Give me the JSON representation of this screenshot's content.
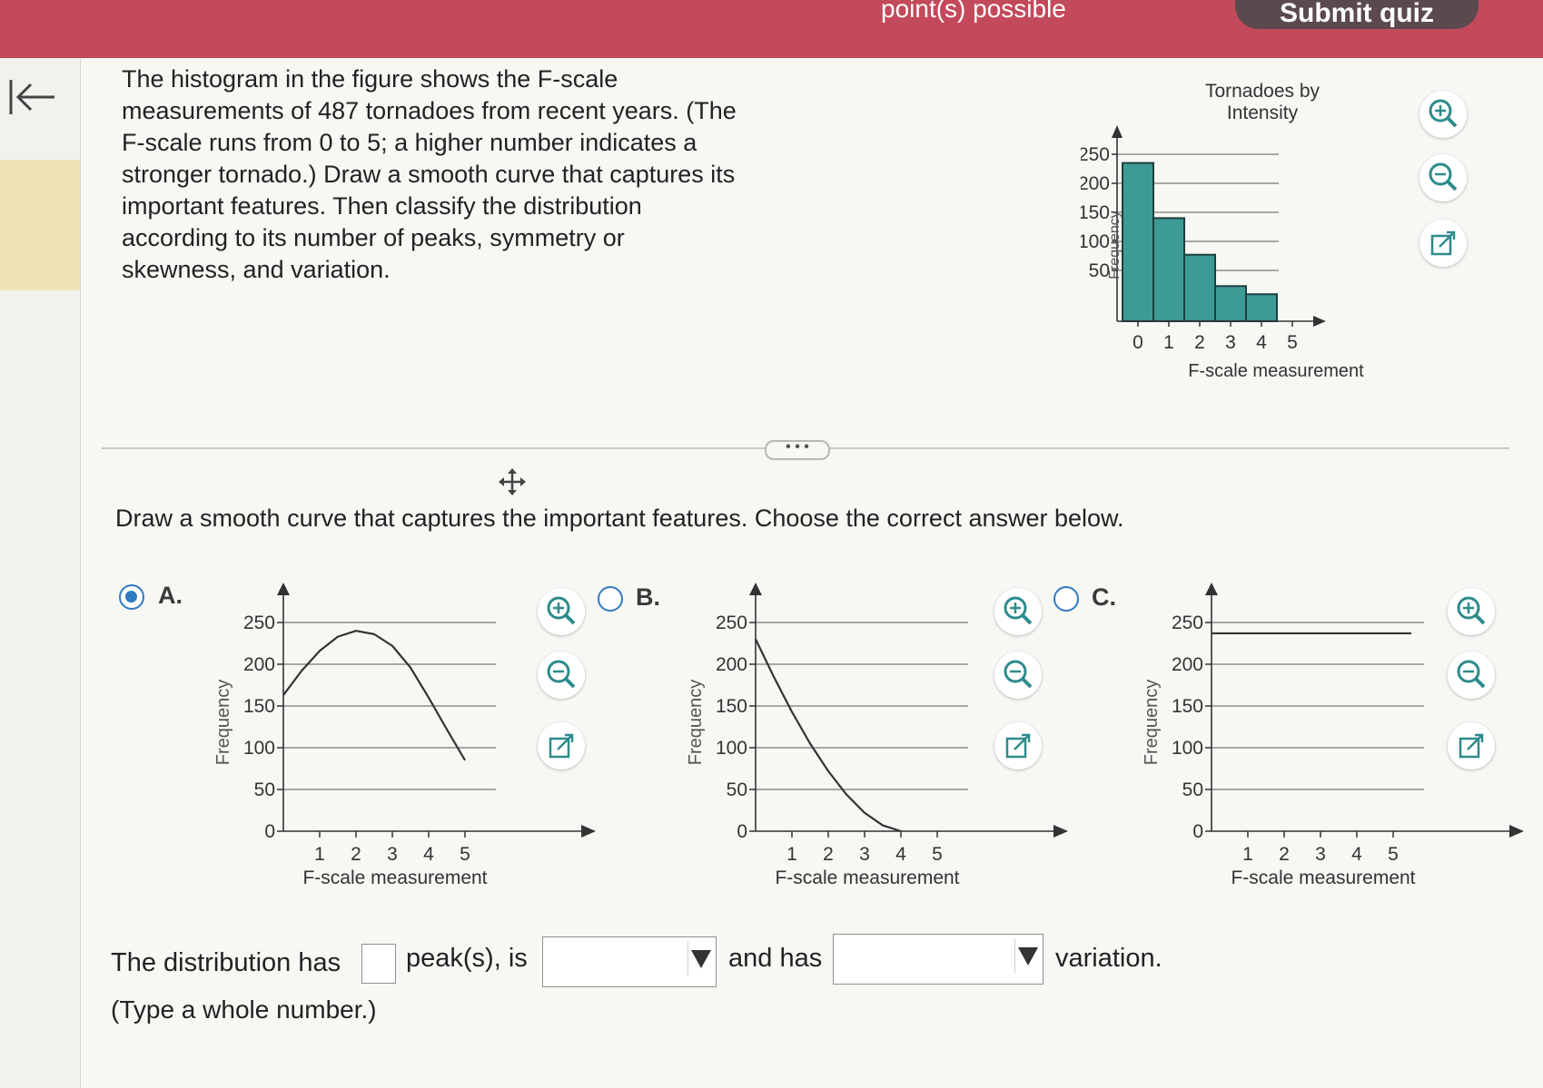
{
  "header": {
    "points_text": "point(s) possible",
    "submit_label": "Submit quiz"
  },
  "question": {
    "text": "The histogram in the figure shows the F-scale measurements of 487 tornadoes from recent years. (The F-scale runs from 0 to 5; a higher number indicates a stronger tornado.) Draw a smooth curve that captures its important features. Then classify the distribution according to its number of peaks, symmetry or skewness, and variation."
  },
  "instruction": "Draw a smooth curve that captures the important features. Choose the correct answer below.",
  "options": [
    {
      "letter": "A.",
      "selected": true
    },
    {
      "letter": "B.",
      "selected": false
    },
    {
      "letter": "C.",
      "selected": false
    }
  ],
  "answer": {
    "part1": "The distribution has",
    "part2": "peak(s), is",
    "part3": "and has",
    "part4": "variation.",
    "peaks_value": "",
    "symmetry_value": "",
    "variation_value": "",
    "hint": "(Type a whole number.)"
  },
  "chart_data": [
    {
      "type": "bar",
      "title": "Tornadoes by Intensity",
      "xlabel": "F-scale measurement",
      "ylabel": "Frequency",
      "categories": [
        "0",
        "1",
        "2",
        "3",
        "4",
        "5"
      ],
      "values": [
        235,
        140,
        77,
        23,
        9,
        0
      ],
      "yticks": [
        50,
        100,
        150,
        200,
        250
      ],
      "ylim": [
        0,
        270
      ],
      "xlim": [
        0,
        6
      ]
    },
    {
      "type": "line",
      "option": "A",
      "xlabel": "F-scale measurement",
      "ylabel": "Frequency",
      "x": [
        0,
        0.5,
        1,
        1.5,
        2,
        2.5,
        3,
        3.5,
        4,
        4.5,
        5
      ],
      "values": [
        163,
        192,
        216,
        233,
        240,
        236,
        222,
        196,
        160,
        122,
        85
      ],
      "xticks": [
        1,
        2,
        3,
        4,
        5
      ],
      "yticks": [
        0,
        50,
        100,
        150,
        200,
        250
      ],
      "ylim": [
        0,
        270
      ],
      "xlim": [
        0,
        6
      ]
    },
    {
      "type": "line",
      "option": "B",
      "xlabel": "F-scale measurement",
      "ylabel": "Frequency",
      "x": [
        0,
        0.5,
        1,
        1.5,
        2,
        2.5,
        3,
        3.5,
        4
      ],
      "values": [
        230,
        185,
        143,
        105,
        72,
        44,
        22,
        7,
        0
      ],
      "xticks": [
        1,
        2,
        3,
        4,
        5
      ],
      "yticks": [
        0,
        50,
        100,
        150,
        200,
        250
      ],
      "ylim": [
        0,
        270
      ],
      "xlim": [
        0,
        6
      ]
    },
    {
      "type": "line",
      "option": "C",
      "xlabel": "F-scale measurement",
      "ylabel": "Frequency",
      "x": [
        0,
        5.5
      ],
      "values": [
        237,
        237
      ],
      "xticks": [
        1,
        2,
        3,
        4,
        5
      ],
      "yticks": [
        0,
        50,
        100,
        150,
        200,
        250
      ],
      "ylim": [
        0,
        270
      ],
      "xlim": [
        0,
        6
      ]
    }
  ]
}
